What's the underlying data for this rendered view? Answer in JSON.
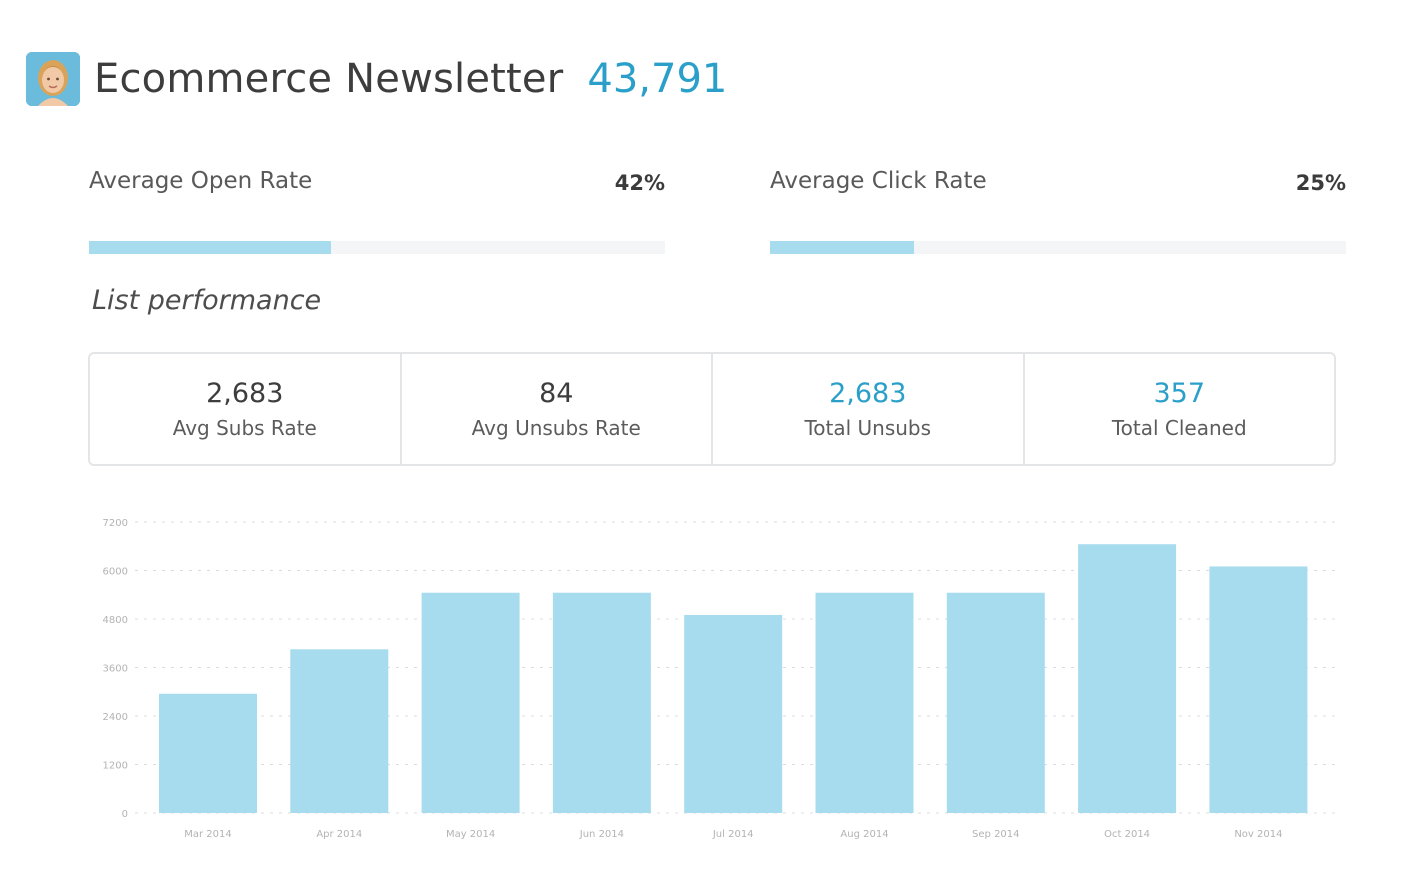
{
  "header": {
    "avatar_icon": "user-avatar-photo",
    "title": "Ecommerce Newsletter",
    "subscriber_count": "43,791",
    "accent_color": "#2a9fc9"
  },
  "metrics": [
    {
      "label": "Average Open Rate",
      "value": "42%",
      "progress": 0.42
    },
    {
      "label": "Average Click Rate",
      "value": "25%",
      "progress": 0.25
    }
  ],
  "section_title": "List performance",
  "stats": [
    {
      "value": "2,683",
      "caption": "Avg Subs Rate",
      "accent": false
    },
    {
      "value": "84",
      "caption": "Avg Unsubs Rate",
      "accent": false
    },
    {
      "value": "2,683",
      "caption": "Total Unsubs",
      "accent": true
    },
    {
      "value": "357",
      "caption": "Total Cleaned",
      "accent": true
    }
  ],
  "chart_data": {
    "type": "bar",
    "categories": [
      "Mar 2014",
      "Apr 2014",
      "May 2014",
      "Jun 2014",
      "Jul 2014",
      "Aug 2014",
      "Sep 2014",
      "Oct 2014",
      "Nov 2014"
    ],
    "values": [
      2950,
      4050,
      5450,
      5450,
      4900,
      5450,
      5450,
      6650,
      6100
    ],
    "ylim": [
      0,
      7200
    ],
    "yticks": [
      "0",
      "1200",
      "2400",
      "3600",
      "4800",
      "6000",
      "7200"
    ],
    "grid": true,
    "bar_color": "#a6dced"
  }
}
